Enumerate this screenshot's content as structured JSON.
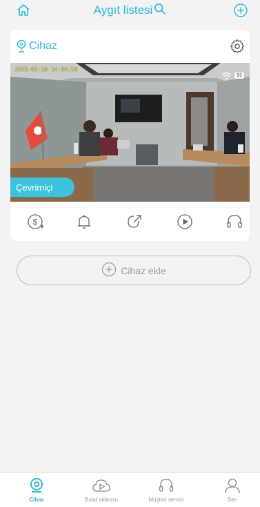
{
  "header": {
    "title": "Aygıt listesi",
    "icons": [
      "home-icon",
      "search-icon",
      "add-circle-icon"
    ]
  },
  "device": {
    "name": "Cihaz",
    "timestamp": "2025-02-10  14:04:50",
    "battery": "91",
    "status": "Çevrimiçi",
    "actions": [
      "dollar-plus-icon",
      "bell-icon",
      "share-arrow-icon",
      "play-icon",
      "headset-icon"
    ]
  },
  "add_device": {
    "label": "Cihaz ekle"
  },
  "nav": {
    "items": [
      {
        "label": "Cihaz",
        "icon": "camera-icon",
        "active": true
      },
      {
        "label": "Bulut videosu",
        "icon": "cloud-play-icon",
        "active": false
      },
      {
        "label": "Müşteri servisi",
        "icon": "headset-icon",
        "active": false
      },
      {
        "label": "Ben",
        "icon": "person-icon",
        "active": false
      }
    ]
  },
  "colors": {
    "accent": "#2fb8d3",
    "online_badge": "#3cc2dc",
    "muted": "#9a9a9a",
    "background": "#f3f3f6"
  }
}
